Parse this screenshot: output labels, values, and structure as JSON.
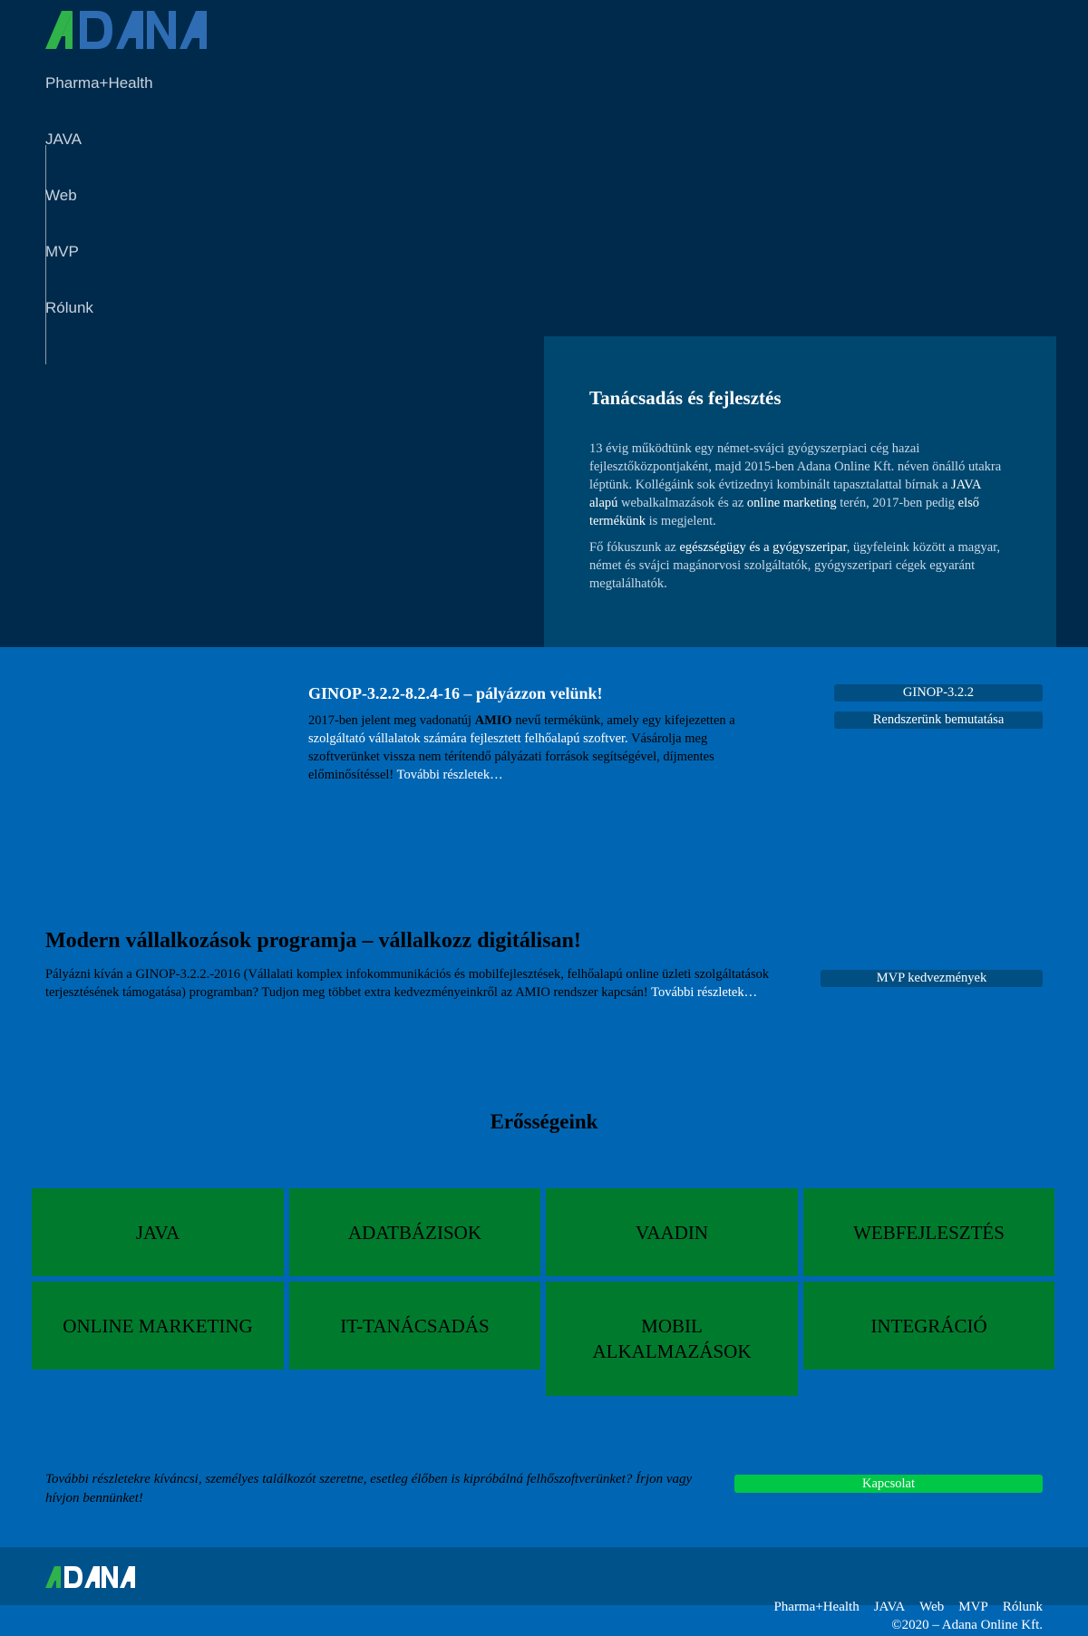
{
  "brand": {
    "logo_text": "ADANA",
    "accent_green": "#2fb34a",
    "accent_blue": "#2e6db4"
  },
  "nav": [
    "Pharma+Health",
    "JAVA",
    "Web",
    "MVP",
    "Rólunk"
  ],
  "intro": {
    "title": "Tanácsadás és fejlesztés",
    "p1_a": "13 évig működtünk egy német-svájci gyógyszerpiaci cég hazai fejlesztőközpontjaként, majd 2015-ben Adana Online Kft. néven önálló utakra léptünk. Kollégáink sok évtizednyi kombinált tapasztalattal bírnak a ",
    "p1_link1": "JAVA alapú",
    "p1_b": " webalkalmazások és az ",
    "p1_link2": "online marketing",
    "p1_c": " terén, 2017-ben pedig ",
    "p1_link3": "első termékünk",
    "p1_d": " is megjelent.",
    "p2_a": "Fő fókuszunk az ",
    "p2_link": "egészségügy és a gyógyszeripar",
    "p2_b": ", ügyfeleink között a magyar, német és svájci magánorvosi szolgáltatók, gyógyszeripari cégek egyaránt megtalálhatók."
  },
  "ginop": {
    "title": "GINOP-3.2.2-8.2.4-16 – pályázzon velünk!",
    "text_a": "2017-ben jelent meg vadonatúj ",
    "text_strong": "AMIO",
    "text_b": " nevű termékünk, amely egy kifejezetten a ",
    "text_light1": "szolgáltató vállalatok számára fejlesztett felhőalapú szoftver.",
    "text_c": " Vásárolja meg szoftverünket vissza nem térítendő pályázati források segítségével, díjmentes előminősítéssel! ",
    "more": "További részletek…",
    "btn1": "GINOP-3.2.2",
    "btn2": "Rendszerünk bemutatása"
  },
  "mvp": {
    "title": "Modern vállalkozások programja – vállalkozz digitálisan!",
    "text": "Pályázni kíván a GINOP-3.2.2.-2016 (Vállalati komplex infokommunikációs és mobilfejlesztések, felhőalapú online üzleti szolgáltatások terjesztésének támogatása) programban? Tudjon meg többet extra kedvezményeinkről az AMIO rendszer kapcsán! ",
    "more": "További részletek…",
    "btn": "MVP kedvezmények"
  },
  "strengths": {
    "title": "Erősségeink",
    "tiles": [
      "JAVA",
      "ADATBÁZISOK",
      "VAADIN",
      "WEBFEJLESZTÉS",
      "ONLINE MARKETING",
      "IT-TANÁCSADÁS",
      "MOBIL ALKALMAZÁSOK",
      "INTEGRÁCIÓ"
    ]
  },
  "contact": {
    "text": "További részletekre kíváncsi, személyes találkozót szeretne, esetleg élőben is kipróbálná felhőszoftverünket? Írjon vagy hívjon bennünket!",
    "btn": "Kapcsolat"
  },
  "footer": {
    "nav": [
      "Pharma+Health",
      "JAVA",
      "Web",
      "MVP",
      "Rólunk"
    ],
    "copyright": "©2020 – Adana Online Kft."
  }
}
